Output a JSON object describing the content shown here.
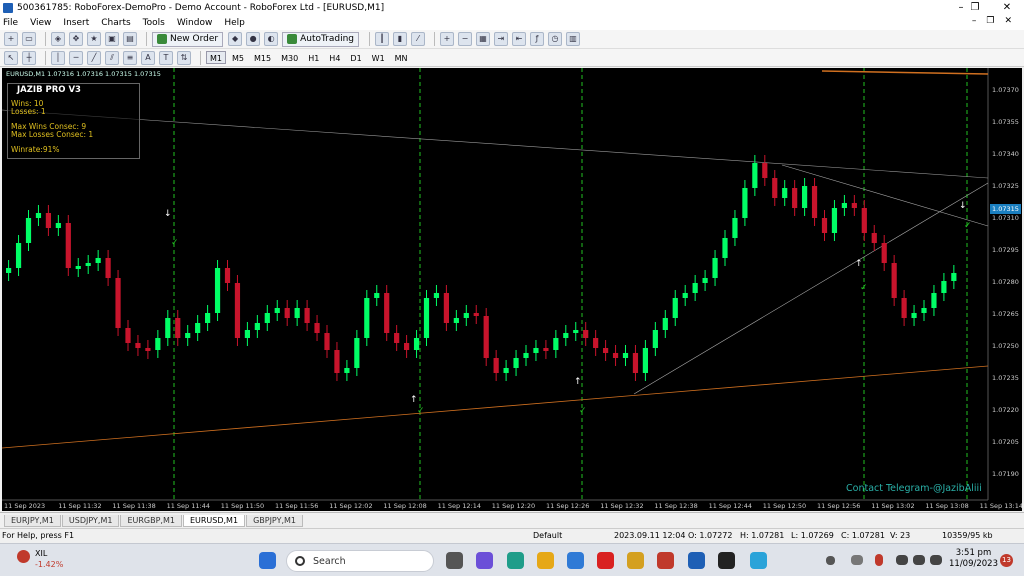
{
  "window": {
    "title": "500361785: RoboForex-DemoPro - Demo Account - RoboForex Ltd - [EURUSD,M1]",
    "controls": [
      "–",
      "❐",
      "✕"
    ]
  },
  "menu": {
    "items": [
      "File",
      "View",
      "Insert",
      "Charts",
      "Tools",
      "Window",
      "Help"
    ],
    "right_controls": [
      "–",
      "❐",
      "✕"
    ]
  },
  "toolbar": {
    "new_order_label": "New Order",
    "autotrading_label": "AutoTrading",
    "timeframes": [
      "M1",
      "M5",
      "M15",
      "M30",
      "H1",
      "H4",
      "D1",
      "W1",
      "MN"
    ],
    "active_timeframe": "M1",
    "text_tool": "A",
    "text_label_tool": "T"
  },
  "chart": {
    "symbol_info": "EURUSD,M1  1.07316 1.07316 1.07315 1.07315",
    "current_price": "1.07315",
    "contact_text": "Contact Telegram-@JazibAliii",
    "price_ticks": [
      "1.07370",
      "1.07355",
      "1.07340",
      "1.07325",
      "1.07310",
      "1.07295",
      "1.07280",
      "1.07265",
      "1.07250",
      "1.07235",
      "1.07220",
      "1.07205",
      "1.07190"
    ],
    "time_ticks": [
      "11 Sep 2023",
      "11 Sep 11:32",
      "11 Sep 11:38",
      "11 Sep 11:44",
      "11 Sep 11:50",
      "11 Sep 11:56",
      "11 Sep 12:02",
      "11 Sep 12:08",
      "11 Sep 12:14",
      "11 Sep 12:20",
      "11 Sep 12:26",
      "11 Sep 12:32",
      "11 Sep 12:38",
      "11 Sep 12:44",
      "11 Sep 12:50",
      "11 Sep 12:56",
      "11 Sep 13:02",
      "11 Sep 13:08",
      "11 Sep 13:14"
    ],
    "colors": {
      "bull": "#00ff66",
      "bear": "#c8142c",
      "signal": "#22c022",
      "background": "#000000"
    }
  },
  "jazib_panel": {
    "title": "JAZIB PRO V3",
    "wins": "Wins: 10",
    "losses": "Losses: 1",
    "max_wins": "Max Wins Consec: 9",
    "max_losses": "Max Losses Consec: 1",
    "winrate": "Winrate:91%"
  },
  "symbol_tabs": [
    "EURJPY,M1",
    "USDJPY,M1",
    "EURGBP,M1",
    "EURUSD,M1",
    "GBPJPY,M1"
  ],
  "active_tab": "EURUSD,M1",
  "status": {
    "help": "For Help, press F1",
    "profile": "Default",
    "datetime": "2023.09.11 12:04",
    "open": "O: 1.07272",
    "high": "H: 1.07281",
    "low": "L: 1.07269",
    "close": "C: 1.07281",
    "volume": "V: 23",
    "traffic": "10359/95 kb"
  },
  "taskbar": {
    "weather_label": "XIL",
    "weather_value": "-1.42%",
    "search_placeholder": "Search",
    "time": "3:51 pm",
    "date": "11/09/2023",
    "notification_count": "13"
  }
}
